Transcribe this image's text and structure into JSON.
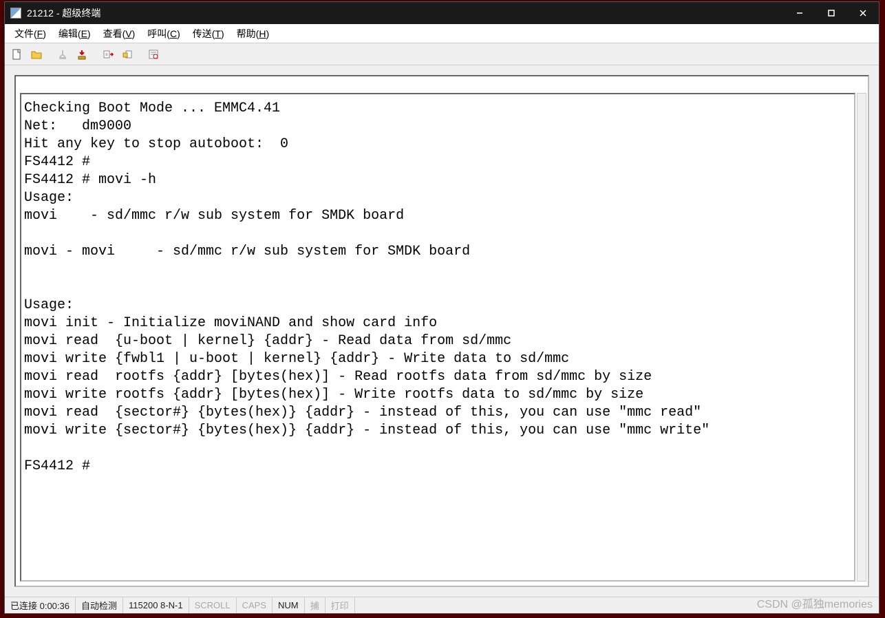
{
  "window": {
    "title": "21212 - 超级终端"
  },
  "menu": {
    "file": {
      "label": "文件",
      "hotkey": "F"
    },
    "edit": {
      "label": "编辑",
      "hotkey": "E"
    },
    "view": {
      "label": "查看",
      "hotkey": "V"
    },
    "call": {
      "label": "呼叫",
      "hotkey": "C"
    },
    "transfer": {
      "label": "传送",
      "hotkey": "T"
    },
    "help": {
      "label": "帮助",
      "hotkey": "H"
    }
  },
  "toolbar_icons": {
    "new": "new-file-icon",
    "open": "open-folder-icon",
    "connect": "connect-icon",
    "disconnect": "disconnect-icon",
    "send": "send-icon",
    "receive": "receive-icon",
    "properties": "properties-icon"
  },
  "terminal_text": "Checking Boot Mode ... EMMC4.41\nNet:   dm9000\nHit any key to stop autoboot:  0\nFS4412 #\nFS4412 # movi -h\nUsage:\nmovi    - sd/mmc r/w sub system for SMDK board\n\nmovi - movi     - sd/mmc r/w sub system for SMDK board\n\n\nUsage:\nmovi init - Initialize moviNAND and show card info\nmovi read  {u-boot | kernel} {addr} - Read data from sd/mmc\nmovi write {fwbl1 | u-boot | kernel} {addr} - Write data to sd/mmc\nmovi read  rootfs {addr} [bytes(hex)] - Read rootfs data from sd/mmc by size\nmovi write rootfs {addr} [bytes(hex)] - Write rootfs data to sd/mmc by size\nmovi read  {sector#} {bytes(hex)} {addr} - instead of this, you can use \"mmc read\"\nmovi write {sector#} {bytes(hex)} {addr} - instead of this, you can use \"mmc write\"\n\nFS4412 #",
  "status": {
    "connection": "已连接 0:00:36",
    "autodetect": "自动检测",
    "port": "115200 8-N-1",
    "scroll": "SCROLL",
    "caps": "CAPS",
    "num": "NUM",
    "capture": "捕",
    "print": "打印"
  },
  "watermark": "CSDN @孤独memories"
}
